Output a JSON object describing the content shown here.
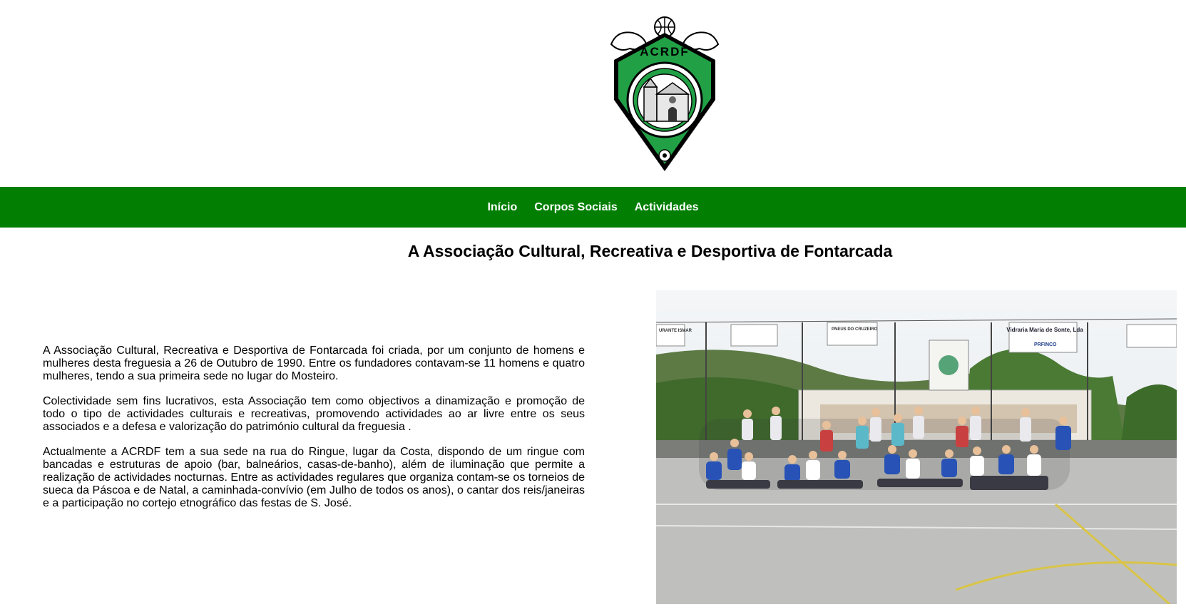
{
  "brand": {
    "logo_text": "ACRDF",
    "logo_ring_text": "ASSOCIAÇÃO CULTURAL RECREATIVA DESPORTIVA FONTARCADA",
    "colors": {
      "green": "#027f03",
      "logo_green": "#21a046"
    }
  },
  "nav": {
    "items": [
      {
        "label": "Início"
      },
      {
        "label": "Corpos Sociais"
      },
      {
        "label": "Actividades"
      }
    ]
  },
  "main": {
    "title": "A Associação Cultural, Recreativa e Desportiva de Fontarcada",
    "paragraphs": [
      "A Associação Cultural, Recreativa e Desportiva de Fontarcada foi criada, por um conjunto de homens e mulheres desta freguesia a 26 de Outubro de 1990. Entre os fundadores contavam-se 11 homens e quatro mulheres, tendo a sua primeira sede no lugar do Mosteiro.",
      "Colectividade sem fins lucrativos, esta Associação tem como objectivos a dinamização e promoção de todo o tipo de actividades culturais e recreativas, promovendo actividades ao ar livre entre os seus associados e a defesa e valorização do património cultural da freguesia .",
      "Actualmente a ACRDF tem a sua sede na rua do Ringue, lugar da Costa, dispondo de um ringue com bancadas e estruturas de apoio (bar, balneários, casas-de-banho), além de iluminação que permite a realização de actividades nocturnas. Entre as actividades regulares que organiza contam-se os torneios de sueca da Páscoa e de Natal, a caminhada-convívio (em Julho de todos os anos), o cantar dos reis/janeiras e a participação no cortejo etnográfico das festas de S. José."
    ]
  },
  "photo": {
    "signs": [
      "URANTE ISMAR",
      "PNEUS DO CRUZEIRO",
      "Vidraria Maria de Sonte, Lda",
      "PRFINCO"
    ]
  }
}
